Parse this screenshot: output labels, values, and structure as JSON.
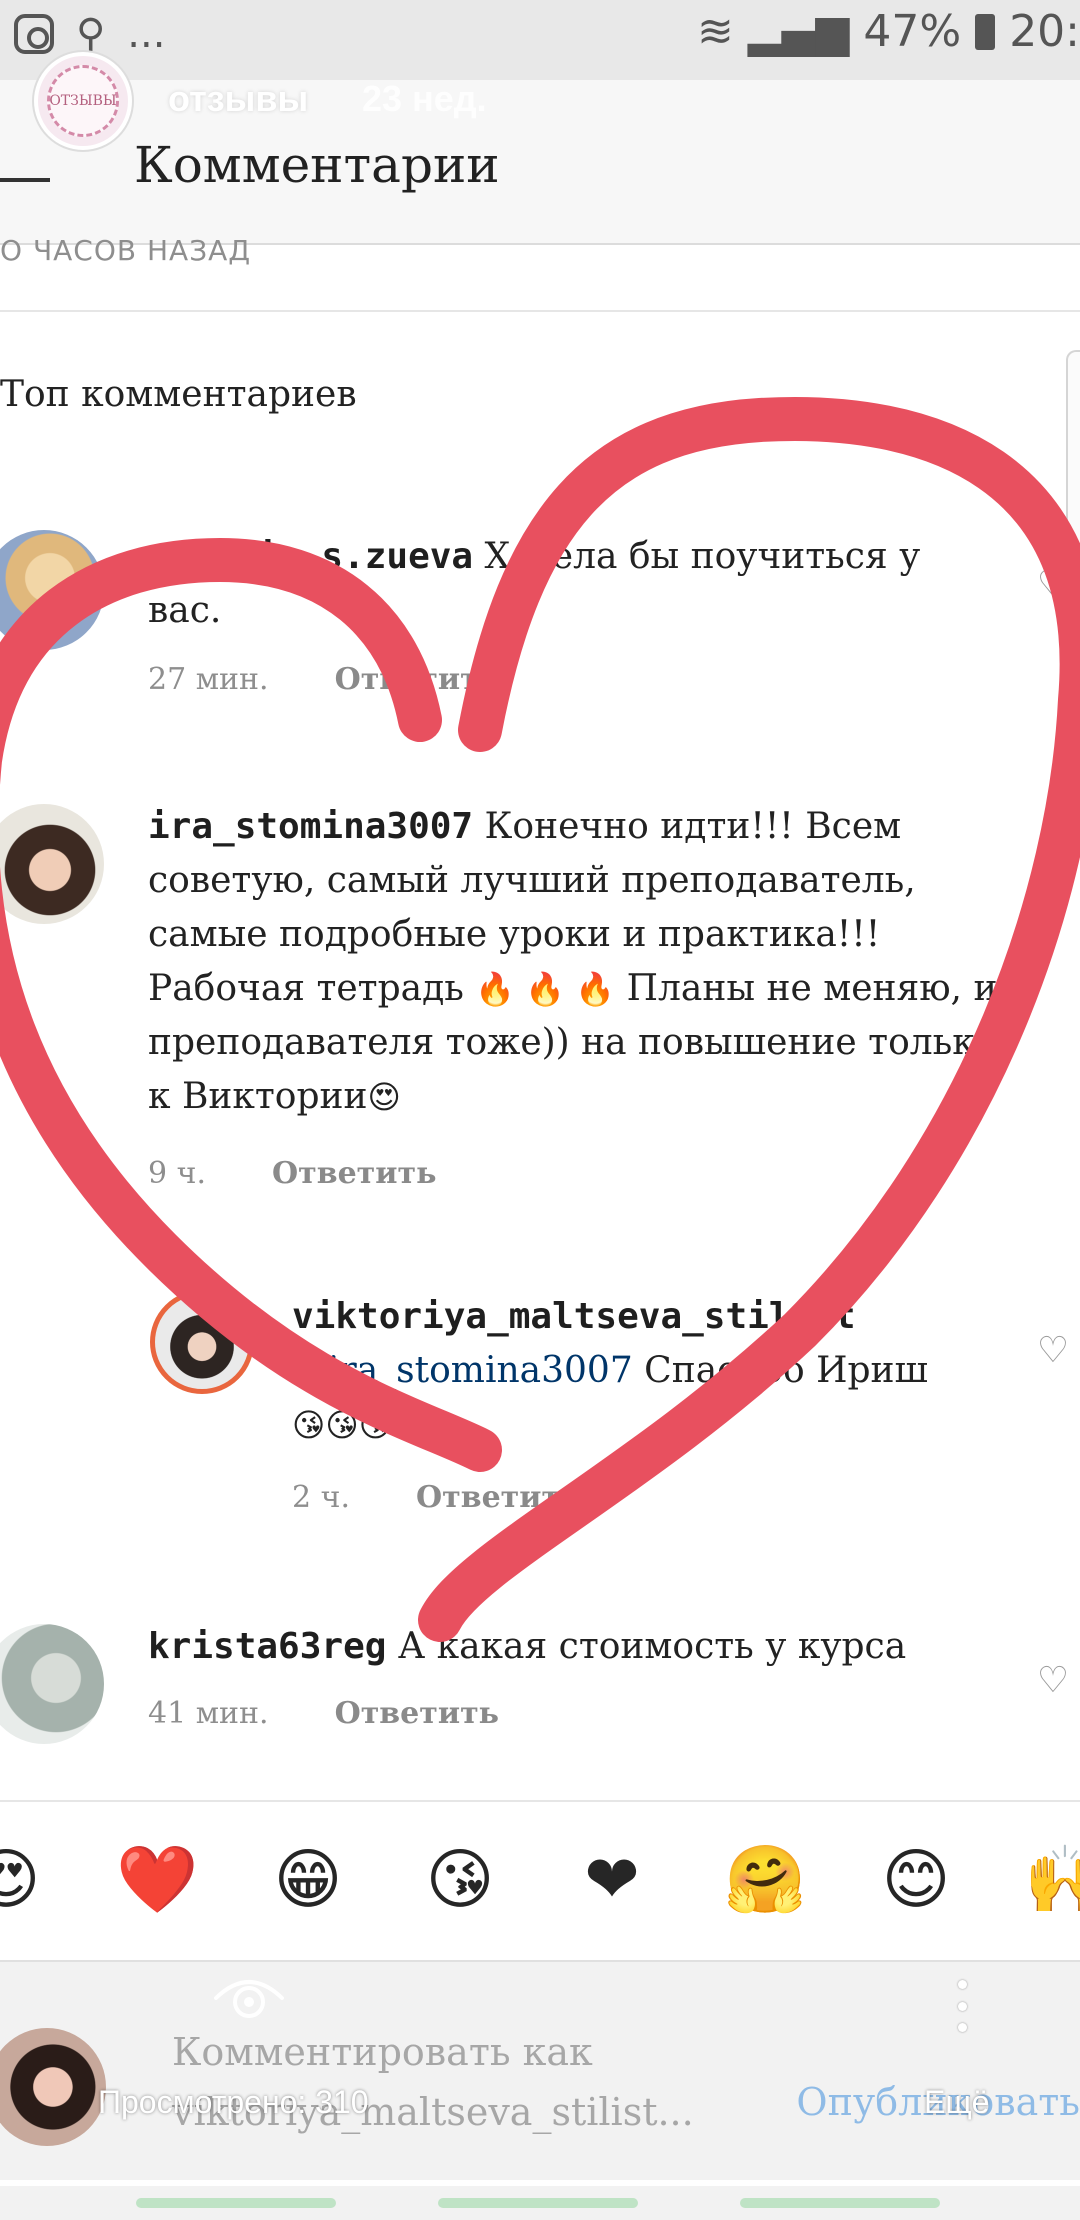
{
  "status_bar": {
    "dots": "...",
    "battery": "47%",
    "time": "20:"
  },
  "story": {
    "avatar_text": "ОТЗЫВЫ",
    "title": "отзывы",
    "age": "23 нед.",
    "views": "Просмотрено: 310",
    "more_label": "Ещё"
  },
  "header": {
    "title": "Комментарии"
  },
  "post_time": "О ЧАСОВ НАЗАД",
  "section_title": "Топ комментариев",
  "comments": [
    {
      "username": "natalia.s.zueva",
      "text": " Хотела бы поучиться у вас.",
      "time": "27 мин.",
      "reply": "Ответить"
    },
    {
      "username": "ira_stomina3007",
      "text_1": " Конечно идти!!! Всем советую, самый лучший преподаватель, самые подробные уроки и практика!!! Рабочая тетрадь",
      "emoji_1": "🔥 🔥 🔥",
      "text_2": " Планы не меняю, и преподавателя тоже)) на повышение только к Виктории",
      "emoji_2": "😍",
      "time": "9 ч.",
      "reply": "Ответить"
    },
    {
      "username": "viktoriya_maltseva_stilist",
      "mention": "@ira_stomina3007",
      "text": " Спасибо Ириш",
      "emoji": "😘😘😘",
      "time": "2 ч.",
      "reply": "Ответить"
    },
    {
      "username": "krista63reg",
      "text": " А какая стоимость у курса",
      "time": "41 мин.",
      "reply": "Ответить"
    }
  ],
  "emoji_bar": [
    "😍",
    "❤️",
    "😁",
    "😘",
    "❤",
    "🤗",
    "😊",
    "🙌"
  ],
  "input": {
    "placeholder": "Комментировать как viktoriya_maltseva_stilist...",
    "publish": "Опубликовать"
  },
  "colors": {
    "heart_overlay": "#e8505f",
    "publish": "#8fbbe6",
    "mention": "#003569"
  }
}
